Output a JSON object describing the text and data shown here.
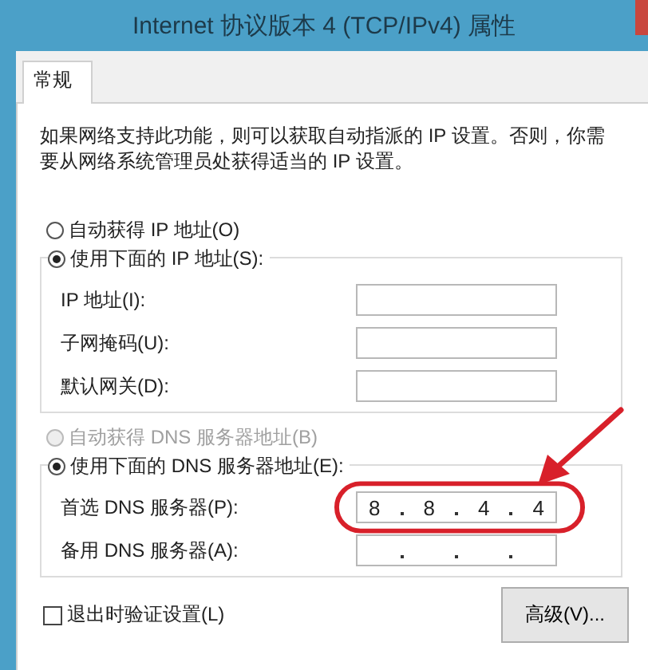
{
  "window": {
    "title": "Internet 协议版本 4 (TCP/IPv4) 属性"
  },
  "tabs": [
    {
      "label": "常规",
      "selected": true
    }
  ],
  "description": "如果网络支持此功能，则可以获取自动指派的 IP 设置。否则，你需要从网络系统管理员处获得适当的 IP 设置。",
  "ip_options": [
    {
      "label": "自动获得 IP 地址(O)",
      "selected": false,
      "disabled": false
    },
    {
      "label": "使用下面的 IP 地址(S):",
      "selected": true,
      "disabled": false
    }
  ],
  "ip_fields": [
    {
      "label": "IP 地址(I):",
      "dots": false,
      "highlighted": false
    },
    {
      "label": "子网掩码(U):",
      "dots": false,
      "highlighted": false
    },
    {
      "label": "默认网关(D):",
      "dots": false,
      "highlighted": false
    }
  ],
  "dns_options": [
    {
      "label": "自动获得 DNS 服务器地址(B)",
      "selected": false,
      "disabled": true
    },
    {
      "label": "使用下面的 DNS 服务器地址(E):",
      "selected": true,
      "disabled": false
    }
  ],
  "dns_fields": [
    {
      "label": "首选 DNS 服务器(P):",
      "octets": [
        "8",
        "8",
        "4",
        "4"
      ],
      "highlighted": true
    },
    {
      "label": "备用 DNS 服务器(A):",
      "dots": true,
      "highlighted": false
    }
  ],
  "validate": {
    "label": "退出时验证设置(L)",
    "checked": false
  },
  "advanced_button": "高级(V)..."
}
